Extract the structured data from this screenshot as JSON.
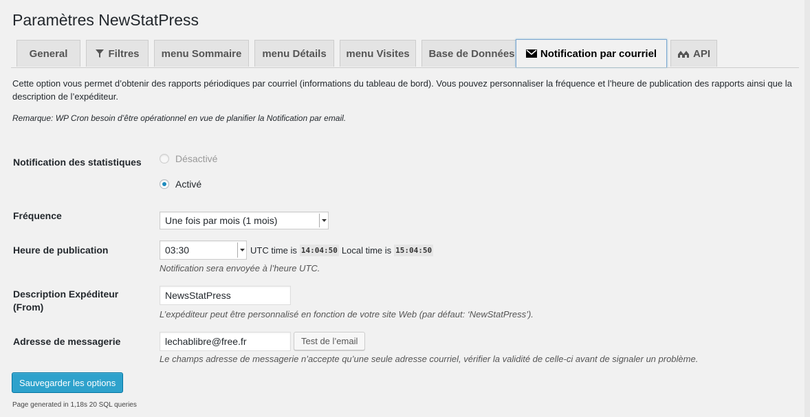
{
  "page": {
    "title": "Paramètres NewStatPress"
  },
  "tabs": [
    {
      "label": "General",
      "icon": ""
    },
    {
      "label": "Filtres",
      "icon": "filter-icon"
    },
    {
      "label": "menu Sommaire",
      "icon": ""
    },
    {
      "label": "menu Détails",
      "icon": ""
    },
    {
      "label": "menu Visites",
      "icon": ""
    },
    {
      "label": "Base de Données",
      "icon": ""
    },
    {
      "label": "Notification par courriel",
      "icon": "envelope-icon",
      "active": true
    },
    {
      "label": "API",
      "icon": "api-icon"
    }
  ],
  "intro": {
    "text": "Cette option vous permet d’obtenir des rapports périodiques par courriel (informations du tableau de bord). Vous pouvez personnaliser la fréquence et l’heure de publication des rapports ainsi que la description de l’expéditeur.",
    "note": "Remarque: WP Cron besoin d’être opérationnel en vue de planifier la Notification par email."
  },
  "form": {
    "notification": {
      "label": "Notification des statistiques",
      "option_off": "Désactivé",
      "option_on": "Activé",
      "selected": "Activé"
    },
    "frequency": {
      "label": "Fréquence",
      "value": "Une fois par mois (1 mois)"
    },
    "publish_time": {
      "label": "Heure de publication",
      "value": "03:30",
      "utc_prefix": "UTC time is",
      "utc_time": "14:04:50",
      "local_prefix": "Local time is",
      "local_time": "15:04:50",
      "desc": "Notification sera envoyée à l’heure UTC."
    },
    "sender": {
      "label_line1": "Description Expéditeur",
      "label_line2": "(From)",
      "value": "NewsStatPress",
      "desc": "L’expéditeur peut être personnalisé en fonction de votre site Web (par défaut: ‘NewStatPress’)."
    },
    "email": {
      "label": "Adresse de messagerie",
      "value": "lechablibre@free.fr",
      "test_button": "Test de l’email",
      "desc": "Le champs adresse de messagerie n’accepte qu’une seule adresse courriel, vérifier la validité de celle-ci avant de signaler un problème."
    }
  },
  "save_button": "Sauvegarder les options",
  "footer": "Page generated in 1,18s 20 SQL queries",
  "colors": {
    "primary": "#2ea2cc",
    "radio_selected": "#1e8cbe",
    "background": "#f1f1f1"
  }
}
